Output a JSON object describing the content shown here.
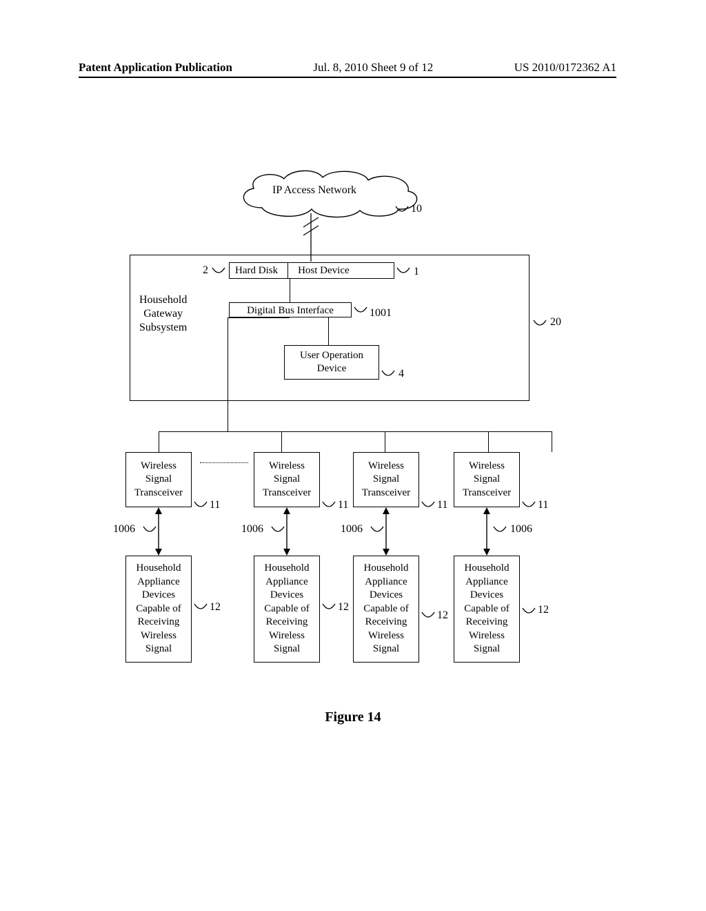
{
  "header": {
    "left": "Patent Application Publication",
    "center": "Jul. 8, 2010  Sheet 9 of 12",
    "right": "US 2010/0172362 A1"
  },
  "figure_caption": "Figure 14",
  "diagram": {
    "cloud": {
      "label": "IP Access Network",
      "ref": "10"
    },
    "gateway": {
      "label": "Household\nGateway\nSubsystem",
      "ref": "20",
      "hard_disk": "Hard Disk",
      "hard_disk_ref": "2",
      "host_device": "Host Device",
      "host_device_ref": "1",
      "digital_bus_interface": "Digital Bus Interface",
      "dbi_ref": "1001",
      "user_op_device": "User Operation\nDevice",
      "uod_ref": "4"
    },
    "transceiver_label": "Wireless\nSignal\nTransceiver",
    "transceiver_ref": "11",
    "link_ref": "1006",
    "appliance_label": "Household\nAppliance\nDevices\nCapable of\nReceiving\nWireless\nSignal",
    "appliance_ref": "12"
  }
}
